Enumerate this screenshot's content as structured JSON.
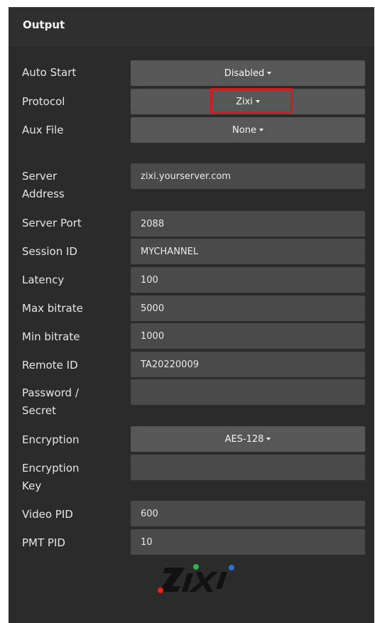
{
  "header": {
    "title": "Output"
  },
  "fields": {
    "auto_start": {
      "label": "Auto Start",
      "value": "Disabled"
    },
    "protocol": {
      "label": "Protocol",
      "value": "Zixi"
    },
    "aux_file": {
      "label": "Aux File",
      "value": "None"
    },
    "server_address": {
      "label_line1": "Server",
      "label_line2": "Address",
      "value": "zixi.yourserver.com"
    },
    "server_port": {
      "label": "Server Port",
      "value": "2088"
    },
    "session_id": {
      "label": "Session ID",
      "value": "MYCHANNEL"
    },
    "latency": {
      "label": "Latency",
      "value": "100"
    },
    "max_bitrate": {
      "label": "Max bitrate",
      "value": "5000"
    },
    "min_bitrate": {
      "label": "Min bitrate",
      "value": "1000"
    },
    "remote_id": {
      "label": "Remote ID",
      "value": "TA20220009"
    },
    "password": {
      "label_line1": "Password /",
      "label_line2": "Secret",
      "value": ""
    },
    "encryption": {
      "label": "Encryption",
      "value": "AES-128"
    },
    "encryption_key": {
      "label_line1": "Encryption",
      "label_line2": "Key",
      "value": ""
    },
    "video_pid": {
      "label": "Video PID",
      "value": "600"
    },
    "pmt_pid": {
      "label": "PMT PID",
      "value": "10"
    }
  },
  "logo": {
    "text": "ZIXI",
    "dot_colors": [
      "#e5231b",
      "#2fb34a",
      "#2b6fd6"
    ]
  },
  "highlight_color": "#d61a1a"
}
